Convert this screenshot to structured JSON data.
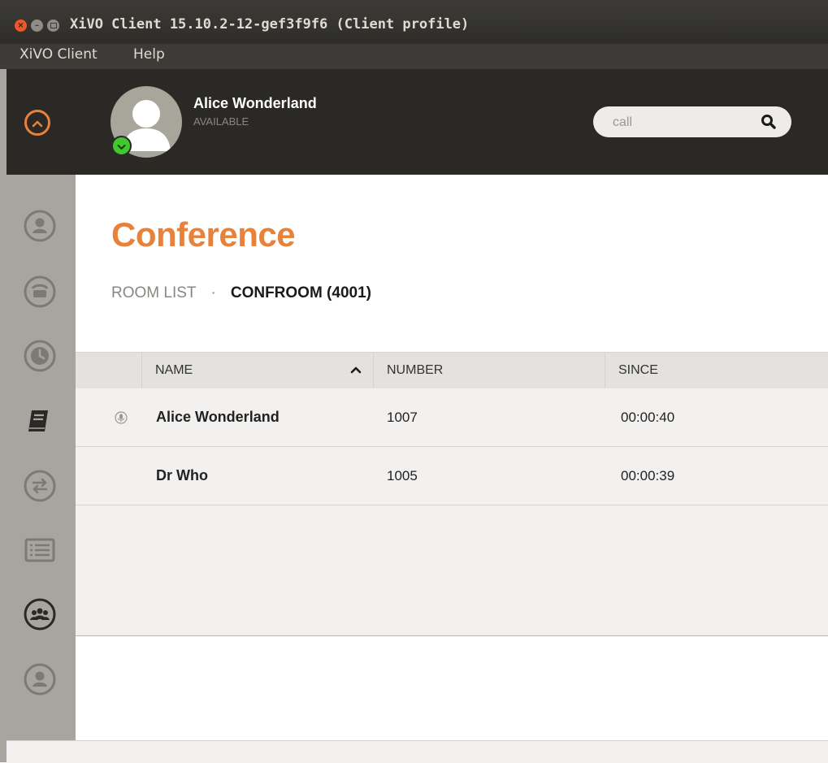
{
  "window": {
    "title": "XiVO Client 15.10.2-12-gef3f9f6 (Client profile)",
    "close_glyph": "×",
    "min_glyph": "–"
  },
  "menubar": {
    "items": [
      "XiVO Client",
      "Help"
    ]
  },
  "header": {
    "user_name": "Alice Wonderland",
    "user_status": "AVAILABLE",
    "status_color": "#3fc92e",
    "search_placeholder": "call"
  },
  "sidebar": {
    "items": [
      {
        "icon": "person-icon",
        "active": false
      },
      {
        "icon": "phone-icon",
        "active": false
      },
      {
        "icon": "clock-icon",
        "active": false
      },
      {
        "icon": "book-icon",
        "active": false
      },
      {
        "icon": "transfer-icon",
        "active": false
      },
      {
        "icon": "list-icon",
        "active": false
      },
      {
        "icon": "conference-icon",
        "active": true
      },
      {
        "icon": "person-icon",
        "active": false
      }
    ]
  },
  "main": {
    "title": "Conference",
    "breadcrumb": {
      "link": "ROOM LIST",
      "separator": "·",
      "current": "CONFROOM (4001)"
    },
    "table": {
      "columns": [
        "NAME",
        "NUMBER",
        "SINCE"
      ],
      "sort_column": "NAME",
      "sort_direction": "ascending",
      "rows": [
        {
          "name": "Alice Wonderland",
          "number": "1007",
          "since": "00:00:40",
          "talking": true
        },
        {
          "name": "Dr Who",
          "number": "1005",
          "since": "00:00:39",
          "talking": false
        }
      ]
    }
  },
  "colors": {
    "accent": "#e8813a",
    "header_bg": "#2b2926",
    "sidebar_bg": "#a8a5a1"
  }
}
